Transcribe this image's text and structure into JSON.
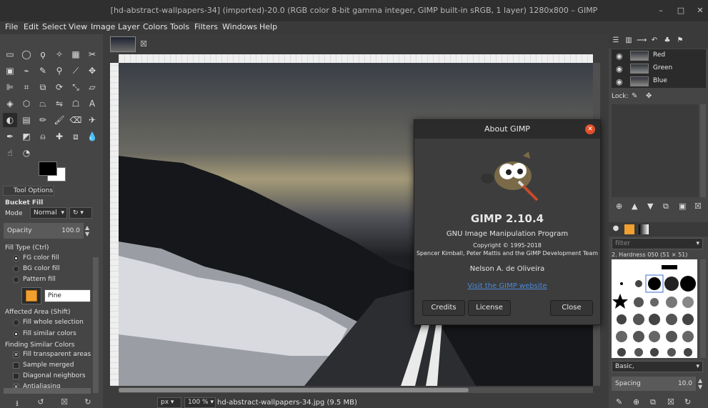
{
  "window": {
    "title": "[hd-abstract-wallpapers-34] (imported)-20.0 (RGB color 8-bit gamma integer, GIMP built-in sRGB, 1 layer) 1280x800 – GIMP",
    "minimize": "–",
    "maximize": "□",
    "close": "✕"
  },
  "menu": [
    "File",
    "Edit",
    "Select",
    "View",
    "Image",
    "Layer",
    "Colors",
    "Tools",
    "Filters",
    "Windows",
    "Help"
  ],
  "tool_options": {
    "tab_label": "Tool Options",
    "tool_name": "Bucket Fill",
    "mode_label": "Mode",
    "mode_value": "Normal",
    "opacity_label": "Opacity",
    "opacity_value": "100.0",
    "fill_type_label": "Fill Type  (Ctrl)",
    "fill_types": [
      "FG color fill",
      "BG color fill",
      "Pattern fill"
    ],
    "fill_type_selected": 0,
    "pattern_name": "Pine",
    "affected_label": "Affected Area  (Shift)",
    "affected_options": [
      "Fill whole selection",
      "Fill similar colors"
    ],
    "affected_selected": 1,
    "finding_label": "Finding Similar Colors",
    "finding_options": [
      {
        "label": "Fill transparent areas",
        "checked": true
      },
      {
        "label": "Sample merged",
        "checked": false
      },
      {
        "label": "Diagonal neighbors",
        "checked": false
      },
      {
        "label": "Antialiasing",
        "checked": true
      }
    ]
  },
  "canvas": {
    "unit": "px",
    "zoom": "100 %",
    "status": "hd-abstract-wallpapers-34.jpg (9.5 MB)"
  },
  "about": {
    "title": "About GIMP",
    "app_name": "GIMP 2.10.4",
    "subtitle": "GNU Image Manipulation Program",
    "copyright": "Copyright © 1995-2018",
    "authors": "Spencer Kimball, Peter Mattis and the GIMP Development Team",
    "tip_author": "Nelson A. de Oliveira",
    "link": "Visit the GIMP website",
    "credits_button": "Credits",
    "license_button": "License",
    "close_button": "Close"
  },
  "channels": [
    {
      "name": "Red"
    },
    {
      "name": "Green"
    },
    {
      "name": "Blue"
    }
  ],
  "lock_label": "Lock:",
  "brushes": {
    "filter_placeholder": "filter",
    "current_brush": "2. Hardness 050 (51 × 51)",
    "preset": "Basic,",
    "spacing_label": "Spacing",
    "spacing_value": "10.0"
  },
  "colors": {
    "accent": "#e0502a",
    "link": "#4a8ad8",
    "pattern": "#f0a030"
  }
}
